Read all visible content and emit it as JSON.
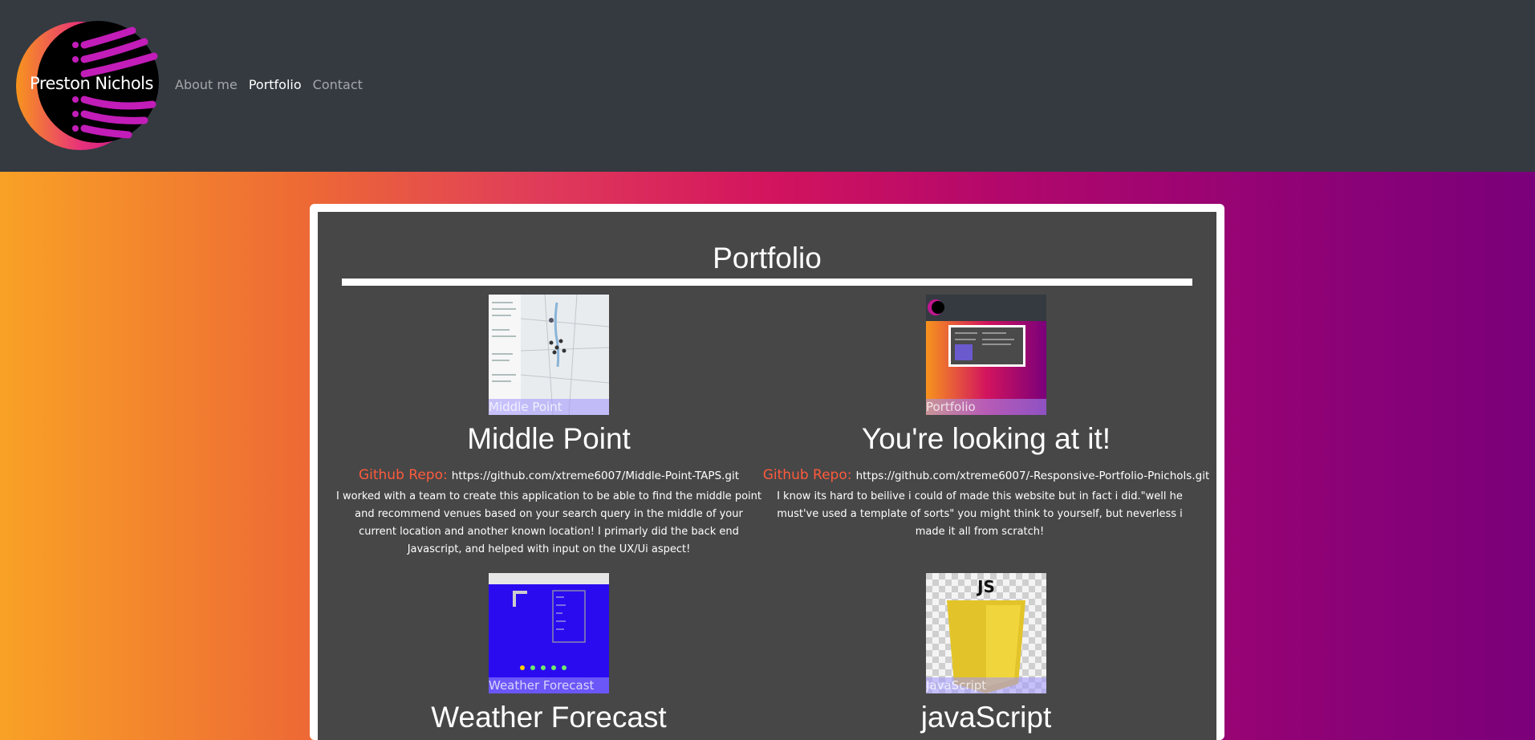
{
  "brand": {
    "name": "Preston Nichols"
  },
  "nav": {
    "items": [
      {
        "label": "About me",
        "active": false
      },
      {
        "label": "Portfolio",
        "active": true
      },
      {
        "label": "Contact",
        "active": false
      }
    ]
  },
  "section": {
    "title": "Portfolio"
  },
  "projects": [
    {
      "caption": "Middle Point",
      "title": "Middle Point",
      "repo_label": "Github Repo:",
      "repo_url": "https://github.com/xtreme6007/Middle-Point-TAPS.git",
      "description": "I worked with a team to create this application to be able to find the middle point and recommend venues based on your search query in the middle of your current location and another known location! I primarly did the back end Javascript, and helped with input on the UX/Ui aspect!"
    },
    {
      "caption": "Portfolio",
      "title": "You're looking at it!",
      "repo_label": "Github Repo:",
      "repo_url": "https://github.com/xtreme6007/-Responsive-Portfolio-Pnichols.git",
      "description": "I know its hard to beilive i could of made this website but in fact i did.\"well he must've used a template of sorts\" you might think to yourself, but neverless i made it all from scratch!"
    },
    {
      "caption": "Weather Forecast",
      "title": "Weather Forecast"
    },
    {
      "caption": "JavaScript",
      "title": "javaScript",
      "logo_text": "JS"
    }
  ],
  "colors": {
    "navbar": "#343a40",
    "card": "#474747",
    "accent": "#ff5a3c"
  }
}
